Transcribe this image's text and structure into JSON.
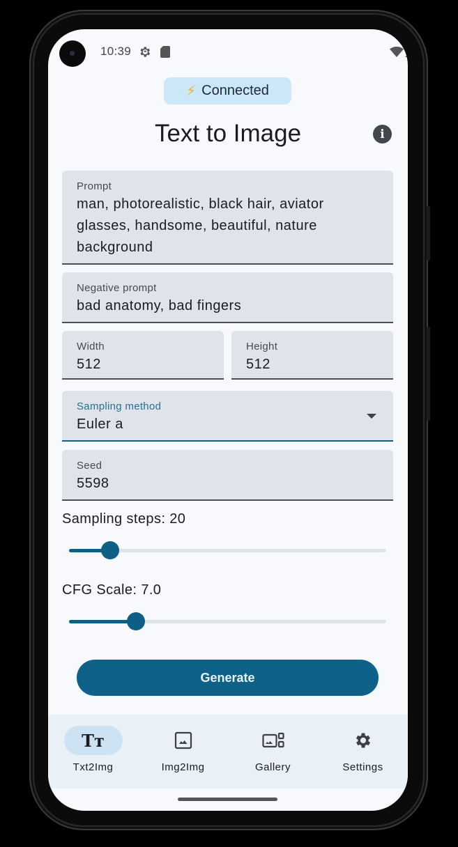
{
  "status_bar": {
    "time": "10:39",
    "left_icons": [
      "settings-gear-icon",
      "sd-card-icon"
    ],
    "right_icons": [
      "wifi-icon",
      "cellular-signal-icon",
      "battery-icon"
    ]
  },
  "connection": {
    "icon": "lightning-bolt-icon",
    "icon_glyph": "⚡",
    "label": "Connected",
    "color": "#cbe7f8"
  },
  "header": {
    "title": "Text to Image",
    "info_icon_glyph": "i"
  },
  "form": {
    "prompt": {
      "label": "Prompt",
      "value": "man, photorealistic, black hair, aviator glasses, handsome, beautiful, nature background"
    },
    "negative_prompt": {
      "label": "Negative prompt",
      "value": "bad anatomy, bad fingers"
    },
    "width": {
      "label": "Width",
      "value": "512"
    },
    "height": {
      "label": "Height",
      "value": "512"
    },
    "sampling_method": {
      "label": "Sampling method",
      "value": "Euler a"
    },
    "seed": {
      "label": "Seed",
      "value": "5598"
    }
  },
  "sliders": {
    "sampling_steps": {
      "label": "Sampling steps: 20",
      "value": 20,
      "fraction": 0.13
    },
    "cfg_scale": {
      "label": "CFG Scale: 7.0",
      "value": 7.0,
      "fraction": 0.21
    }
  },
  "actions": {
    "generate_label": "Generate"
  },
  "bottom_nav": {
    "items": [
      {
        "label": "Txt2Img",
        "icon": "text-format-icon",
        "glyph": "Tт",
        "active": true
      },
      {
        "label": "Img2Img",
        "icon": "image-icon",
        "active": false
      },
      {
        "label": "Gallery",
        "icon": "gallery-icon",
        "active": false
      },
      {
        "label": "Settings",
        "icon": "settings-icon",
        "active": false
      }
    ]
  },
  "colors": {
    "primary": "#0e6189",
    "field_bg": "#dfe4eb",
    "nav_bg": "#e9f0f6",
    "active_pill": "#cde3f3"
  }
}
